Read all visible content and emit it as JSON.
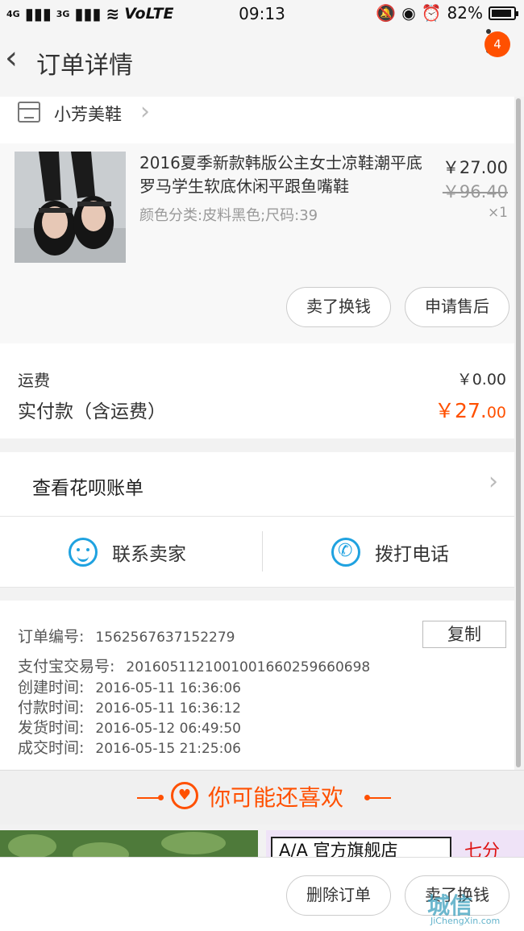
{
  "status": {
    "signal1": "4G",
    "signal2": "3G",
    "volte": "VoLTE",
    "time": "09:13",
    "battery": "82%"
  },
  "header": {
    "title": "订单详情",
    "notification_count": "4"
  },
  "shop": {
    "name": "小芳美鞋"
  },
  "product": {
    "title": "2016夏季新款韩版公主女士凉鞋潮平底罗马学生软底休闲平跟鱼嘴鞋",
    "sku": "颜色分类:皮料黑色;尺码:39",
    "price": "￥27.00",
    "original_price": "￥96.40",
    "quantity": "×1",
    "sell_button": "卖了换钱",
    "after_sale_button": "申请售后"
  },
  "fees": {
    "shipping_label": "运费",
    "shipping_value": "￥0.00",
    "paid_label": "实付款（含运费）",
    "paid_value_main": "￥27.",
    "paid_value_cents": "00"
  },
  "huabei": {
    "label": "查看花呗账单"
  },
  "contact": {
    "seller_label": "联系卖家",
    "call_label": "拨打电话"
  },
  "order_info": {
    "copy_button": "复制",
    "rows": [
      {
        "label": "订单编号:",
        "value": "1562567637152279"
      },
      {
        "label": "支付宝交易号:",
        "value": "2016051121001001660259660698"
      },
      {
        "label": "创建时间:",
        "value": "2016-05-11 16:36:06"
      },
      {
        "label": "付款时间:",
        "value": "2016-05-11 16:36:12"
      },
      {
        "label": "发货时间:",
        "value": "2016-05-12 06:49:50"
      },
      {
        "label": "成交时间:",
        "value": "2016-05-15 21:25:06"
      }
    ]
  },
  "recommend": {
    "title": "你可能还喜欢",
    "brand_text": "官方旗舰店",
    "brand_logo": "A/A",
    "brand_side": "七分"
  },
  "bottom": {
    "delete_button": "删除订单",
    "sell_button": "卖了换钱"
  },
  "watermark": {
    "text": "城信",
    "url": "JiChengXin.com"
  },
  "colors": {
    "accent": "#ff5000",
    "icon_blue": "#1fa2e0"
  }
}
